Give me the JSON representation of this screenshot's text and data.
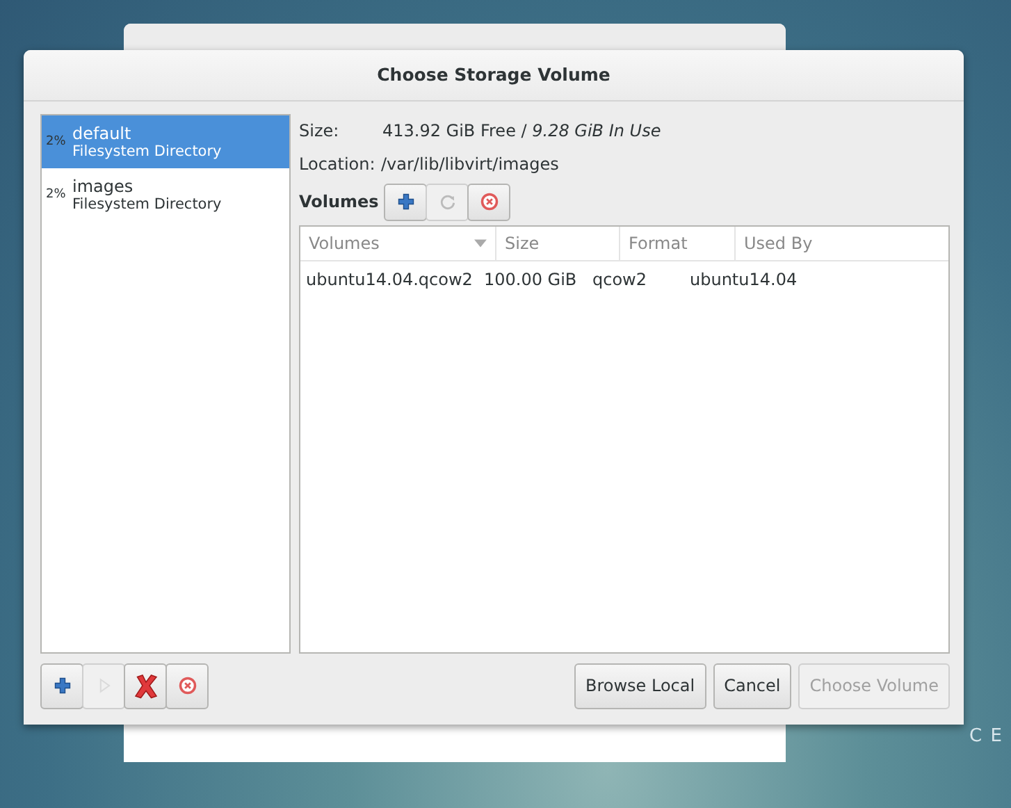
{
  "desktop_text": "C E",
  "dialog": {
    "title": "Choose Storage Volume"
  },
  "pools": [
    {
      "usage": "2%",
      "name": "default",
      "type": "Filesystem Directory",
      "selected": true
    },
    {
      "usage": "2%",
      "name": "images",
      "type": "Filesystem Directory",
      "selected": false
    }
  ],
  "details": {
    "size_label": "Size:",
    "size_free": "413.92 GiB Free / ",
    "size_in_use": "9.28 GiB In Use",
    "location_label": "Location:",
    "location": "/var/lib/libvirt/images"
  },
  "volumes_toolbar": {
    "label": "Volumes",
    "buttons": [
      {
        "kind": "add",
        "disabled": false
      },
      {
        "kind": "refresh",
        "disabled": true
      },
      {
        "kind": "delete",
        "disabled": false
      }
    ]
  },
  "table": {
    "columns": [
      {
        "label": "Volumes",
        "sorted": true
      },
      {
        "label": "Size",
        "sorted": false
      },
      {
        "label": "Format",
        "sorted": false
      },
      {
        "label": "Used By",
        "sorted": false
      }
    ],
    "rows": [
      [
        "ubuntu14.04.qcow2",
        "100.00 GiB",
        "qcow2",
        "ubuntu14.04"
      ]
    ]
  },
  "pool_buttons": [
    {
      "kind": "add",
      "disabled": false
    },
    {
      "kind": "start",
      "disabled": true
    },
    {
      "kind": "stop",
      "disabled": false
    },
    {
      "kind": "delete",
      "disabled": false
    }
  ],
  "buttons": [
    {
      "label": "Browse Local",
      "disabled": false
    },
    {
      "label": "Cancel",
      "disabled": false
    },
    {
      "label": "Choose Volume",
      "disabled": true
    }
  ]
}
